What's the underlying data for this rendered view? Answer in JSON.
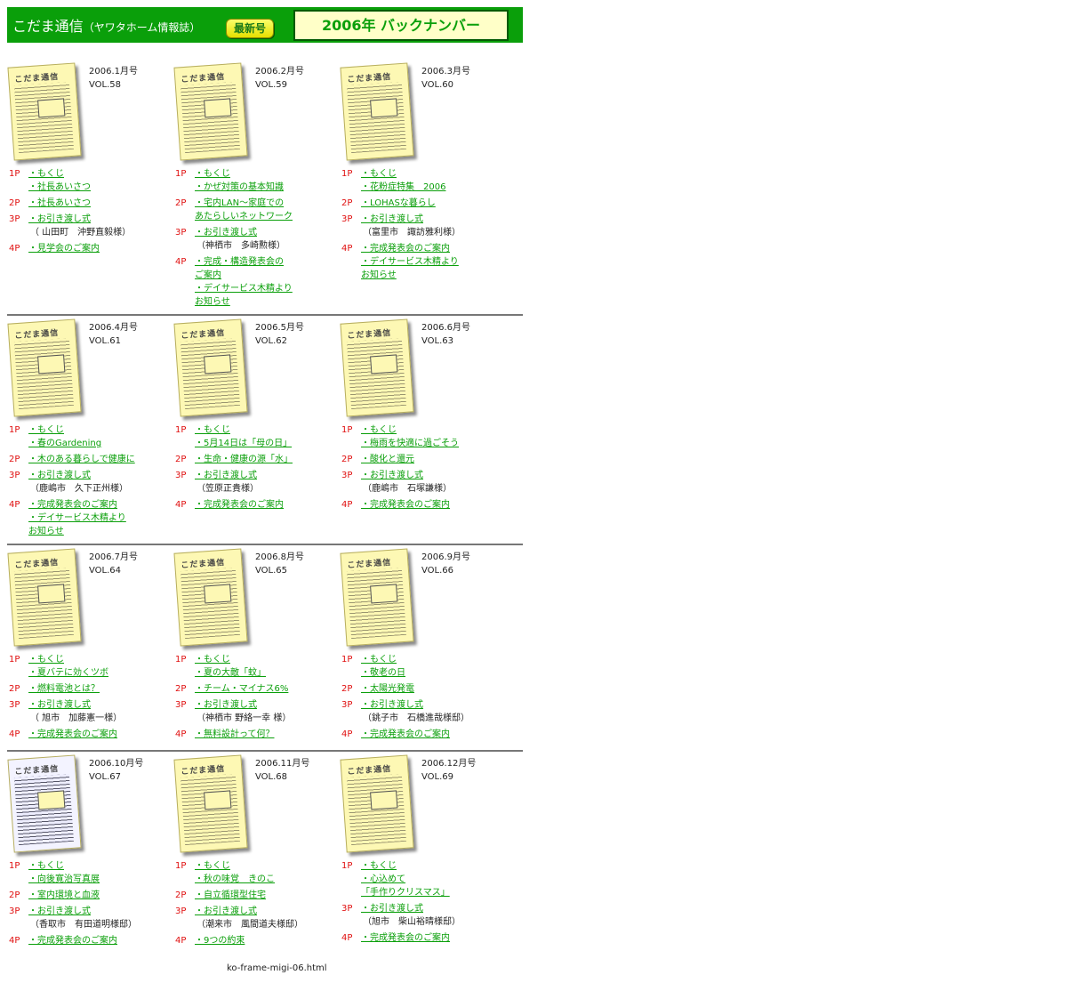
{
  "header": {
    "title": "こだま通信",
    "subtitle": "（ヤワタホーム情報誌）",
    "latest_button": "最新号",
    "year_title": "2006年 バックナンバー",
    "bg_color": "#0a9f0a"
  },
  "issues": [
    {
      "date": "2006.1月号",
      "vol": "VOL.58",
      "toc": [
        {
          "page": "1P",
          "items": [
            {
              "text": "・もくじ",
              "link": true
            },
            {
              "text": "・社長あいさつ",
              "link": true
            }
          ]
        },
        {
          "page": "2P",
          "items": [
            {
              "text": "・社長あいさつ",
              "link": true
            }
          ]
        },
        {
          "page": "3P",
          "items": [
            {
              "text": "・お引き渡し式",
              "link": true
            },
            {
              "text": "（ 山田町　沖野直毅様）",
              "link": false
            }
          ]
        },
        {
          "page": "4P",
          "items": [
            {
              "text": "・見学会のご案内",
              "link": true
            }
          ]
        }
      ]
    },
    {
      "date": "2006.2月号",
      "vol": "VOL.59",
      "toc": [
        {
          "page": "1P",
          "items": [
            {
              "text": "・もくじ",
              "link": true
            },
            {
              "text": "・かぜ対策の基本知識",
              "link": true
            }
          ]
        },
        {
          "page": "2P",
          "items": [
            {
              "text": "・宅内LAN～家庭での",
              "link": true
            },
            {
              "text": "あたらしいネットワーク",
              "link": true
            }
          ]
        },
        {
          "page": "3P",
          "items": [
            {
              "text": "・お引き渡し式",
              "link": true
            },
            {
              "text": "（神栖市　多崎勲様）",
              "link": false
            }
          ]
        },
        {
          "page": "4P",
          "items": [
            {
              "text": "・完成・構造発表会の",
              "link": true
            },
            {
              "text": "ご案内",
              "link": true
            },
            {
              "text": "・デイサービス木精より",
              "link": true
            },
            {
              "text": "お知らせ",
              "link": true
            }
          ]
        }
      ]
    },
    {
      "date": "2006.3月号",
      "vol": "VOL.60",
      "toc": [
        {
          "page": "1P",
          "items": [
            {
              "text": "・もくじ",
              "link": true
            },
            {
              "text": "・花粉症特集　2006",
              "link": true
            }
          ]
        },
        {
          "page": "2P",
          "items": [
            {
              "text": "・LOHASな暮らし",
              "link": true
            }
          ]
        },
        {
          "page": "3P",
          "items": [
            {
              "text": "・お引き渡し式",
              "link": true
            },
            {
              "text": "（富里市　諏訪雅利様）",
              "link": false
            }
          ]
        },
        {
          "page": "4P",
          "items": [
            {
              "text": "・完成発表会のご案内",
              "link": true
            },
            {
              "text": "・デイサービス木精より",
              "link": true
            },
            {
              "text": "お知らせ",
              "link": true
            }
          ]
        }
      ]
    },
    {
      "date": "2006.4月号",
      "vol": "VOL.61",
      "toc": [
        {
          "page": "1P",
          "items": [
            {
              "text": "・もくじ",
              "link": true
            },
            {
              "text": "・春のGardening",
              "link": true
            }
          ]
        },
        {
          "page": "2P",
          "items": [
            {
              "text": "・木のある暮らしで健康に",
              "link": true
            }
          ]
        },
        {
          "page": "3P",
          "items": [
            {
              "text": "・お引き渡し式",
              "link": true
            },
            {
              "text": "（鹿嶋市　久下正州様）",
              "link": false
            }
          ]
        },
        {
          "page": "4P",
          "items": [
            {
              "text": "・完成発表会のご案内",
              "link": true
            },
            {
              "text": "・デイサービス木精より",
              "link": true
            },
            {
              "text": "お知らせ",
              "link": true
            }
          ]
        }
      ]
    },
    {
      "date": "2006.5月号",
      "vol": "VOL.62",
      "toc": [
        {
          "page": "1P",
          "items": [
            {
              "text": "・もくじ",
              "link": true
            },
            {
              "text": "・5月14日は「母の日」",
              "link": true
            }
          ]
        },
        {
          "page": "2P",
          "items": [
            {
              "text": "・生命・健康の源「水」",
              "link": true
            }
          ]
        },
        {
          "page": "3P",
          "items": [
            {
              "text": "・お引き渡し式",
              "link": true
            },
            {
              "text": "（笠原正貴様）",
              "link": false
            }
          ]
        },
        {
          "page": "4P",
          "items": [
            {
              "text": "・完成発表会のご案内",
              "link": true
            }
          ]
        }
      ]
    },
    {
      "date": "2006.6月号",
      "vol": "VOL.63",
      "toc": [
        {
          "page": "1P",
          "items": [
            {
              "text": "・もくじ",
              "link": true
            },
            {
              "text": "・梅雨を快適に過ごそう",
              "link": true
            }
          ]
        },
        {
          "page": "2P",
          "items": [
            {
              "text": "・酸化と還元",
              "link": true
            }
          ]
        },
        {
          "page": "3P",
          "items": [
            {
              "text": "・お引き渡し式",
              "link": true
            },
            {
              "text": "（鹿嶋市　石塚謙様）",
              "link": false
            }
          ]
        },
        {
          "page": "4P",
          "items": [
            {
              "text": "・完成発表会のご案内",
              "link": true
            }
          ]
        }
      ]
    },
    {
      "date": "2006.7月号",
      "vol": "VOL.64",
      "toc": [
        {
          "page": "1P",
          "items": [
            {
              "text": "・もくじ",
              "link": true
            },
            {
              "text": "・夏バテに効くツボ",
              "link": true
            }
          ]
        },
        {
          "page": "2P",
          "items": [
            {
              "text": "・燃料電池とは？",
              "link": true
            }
          ]
        },
        {
          "page": "3P",
          "items": [
            {
              "text": "・お引き渡し式",
              "link": true
            },
            {
              "text": "（ 旭市　加藤憲一様）",
              "link": false
            }
          ]
        },
        {
          "page": "4P",
          "items": [
            {
              "text": "・完成発表会のご案内",
              "link": true
            }
          ]
        }
      ]
    },
    {
      "date": "2006.8月号",
      "vol": "VOL.65",
      "toc": [
        {
          "page": "1P",
          "items": [
            {
              "text": "・もくじ",
              "link": true
            },
            {
              "text": "・夏の大敵「蚊」",
              "link": true
            }
          ]
        },
        {
          "page": "2P",
          "items": [
            {
              "text": "・チーム・マイナス6%",
              "link": true
            }
          ]
        },
        {
          "page": "3P",
          "items": [
            {
              "text": "・お引き渡し式",
              "link": true
            },
            {
              "text": "（神栖市 野絡一幸 様）",
              "link": false
            }
          ]
        },
        {
          "page": "4P",
          "items": [
            {
              "text": "・無料設計って何？",
              "link": true
            }
          ]
        }
      ]
    },
    {
      "date": "2006.9月号",
      "vol": "VOL.66",
      "toc": [
        {
          "page": "1P",
          "items": [
            {
              "text": "・もくじ",
              "link": true
            },
            {
              "text": "・敬老の日",
              "link": true
            }
          ]
        },
        {
          "page": "2P",
          "items": [
            {
              "text": "・太陽光発電",
              "link": true
            }
          ]
        },
        {
          "page": "3P",
          "items": [
            {
              "text": "・お引き渡し式",
              "link": true
            },
            {
              "text": "（銚子市　石橋進哉様邸）",
              "link": false
            }
          ]
        },
        {
          "page": "4P",
          "items": [
            {
              "text": "・完成発表会のご案内",
              "link": true
            }
          ]
        }
      ]
    },
    {
      "date": "2006.10月号",
      "vol": "VOL.67",
      "toc": [
        {
          "page": "1P",
          "items": [
            {
              "text": "・もくじ",
              "link": true
            },
            {
              "text": "・向後寛治写真展",
              "link": true
            }
          ]
        },
        {
          "page": "2P",
          "items": [
            {
              "text": "・室内環境と血液",
              "link": true
            }
          ]
        },
        {
          "page": "3P",
          "items": [
            {
              "text": "・お引き渡し式",
              "link": true
            },
            {
              "text": "（香取市　有田道明様邸）",
              "link": false
            }
          ]
        },
        {
          "page": "4P",
          "items": [
            {
              "text": "・完成発表会のご案内",
              "link": true
            }
          ]
        }
      ]
    },
    {
      "date": "2006.11月号",
      "vol": "VOL.68",
      "toc": [
        {
          "page": "1P",
          "items": [
            {
              "text": "・もくじ",
              "link": true
            },
            {
              "text": "・秋の味覚　きのこ",
              "link": true
            }
          ]
        },
        {
          "page": "2P",
          "items": [
            {
              "text": "・自立循環型住宅",
              "link": true
            }
          ]
        },
        {
          "page": "3P",
          "items": [
            {
              "text": "・お引き渡し式",
              "link": true
            },
            {
              "text": "（潮来市　風間道夫様邸）",
              "link": false
            }
          ]
        },
        {
          "page": "4P",
          "items": [
            {
              "text": "・9つの約束",
              "link": true
            }
          ]
        }
      ]
    },
    {
      "date": "2006.12月号",
      "vol": "VOL.69",
      "toc": [
        {
          "page": "1P",
          "items": [
            {
              "text": "・もくじ",
              "link": true
            },
            {
              "text": "・心込めて",
              "link": true
            },
            {
              "text": "「手作りクリスマス」",
              "link": true
            }
          ]
        },
        {
          "page": "3P",
          "items": [
            {
              "text": "・お引き渡し式",
              "link": true
            },
            {
              "text": "（旭市　柴山裕晴様邸）",
              "link": false
            }
          ]
        },
        {
          "page": "4P",
          "items": [
            {
              "text": "・完成発表会のご案内",
              "link": true
            }
          ]
        }
      ]
    }
  ],
  "thumb_masthead": "こだま通信",
  "footer": {
    "filename": "ko-frame-migi-06.html"
  }
}
